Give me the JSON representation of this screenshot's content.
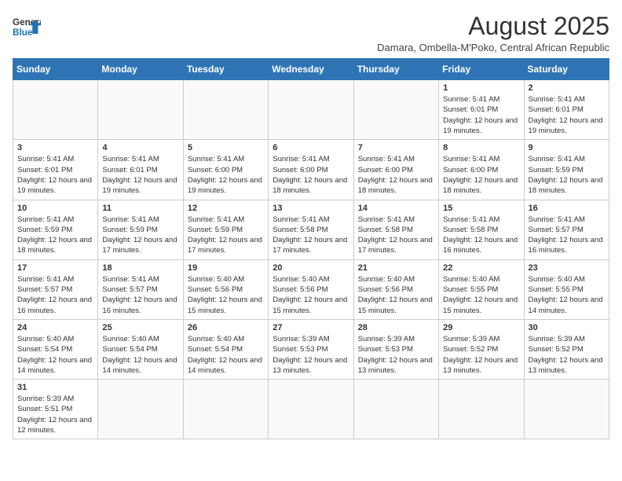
{
  "logo": {
    "general": "General",
    "blue": "Blue"
  },
  "header": {
    "month_year": "August 2025",
    "subtitle": "Damara, Ombella-M'Poko, Central African Republic"
  },
  "days_of_week": [
    "Sunday",
    "Monday",
    "Tuesday",
    "Wednesday",
    "Thursday",
    "Friday",
    "Saturday"
  ],
  "weeks": [
    [
      {
        "day": "",
        "info": ""
      },
      {
        "day": "",
        "info": ""
      },
      {
        "day": "",
        "info": ""
      },
      {
        "day": "",
        "info": ""
      },
      {
        "day": "",
        "info": ""
      },
      {
        "day": "1",
        "info": "Sunrise: 5:41 AM\nSunset: 6:01 PM\nDaylight: 12 hours and 19 minutes."
      },
      {
        "day": "2",
        "info": "Sunrise: 5:41 AM\nSunset: 6:01 PM\nDaylight: 12 hours and 19 minutes."
      }
    ],
    [
      {
        "day": "3",
        "info": "Sunrise: 5:41 AM\nSunset: 6:01 PM\nDaylight: 12 hours and 19 minutes."
      },
      {
        "day": "4",
        "info": "Sunrise: 5:41 AM\nSunset: 6:01 PM\nDaylight: 12 hours and 19 minutes."
      },
      {
        "day": "5",
        "info": "Sunrise: 5:41 AM\nSunset: 6:00 PM\nDaylight: 12 hours and 19 minutes."
      },
      {
        "day": "6",
        "info": "Sunrise: 5:41 AM\nSunset: 6:00 PM\nDaylight: 12 hours and 18 minutes."
      },
      {
        "day": "7",
        "info": "Sunrise: 5:41 AM\nSunset: 6:00 PM\nDaylight: 12 hours and 18 minutes."
      },
      {
        "day": "8",
        "info": "Sunrise: 5:41 AM\nSunset: 6:00 PM\nDaylight: 12 hours and 18 minutes."
      },
      {
        "day": "9",
        "info": "Sunrise: 5:41 AM\nSunset: 5:59 PM\nDaylight: 12 hours and 18 minutes."
      }
    ],
    [
      {
        "day": "10",
        "info": "Sunrise: 5:41 AM\nSunset: 5:59 PM\nDaylight: 12 hours and 18 minutes."
      },
      {
        "day": "11",
        "info": "Sunrise: 5:41 AM\nSunset: 5:59 PM\nDaylight: 12 hours and 17 minutes."
      },
      {
        "day": "12",
        "info": "Sunrise: 5:41 AM\nSunset: 5:59 PM\nDaylight: 12 hours and 17 minutes."
      },
      {
        "day": "13",
        "info": "Sunrise: 5:41 AM\nSunset: 5:58 PM\nDaylight: 12 hours and 17 minutes."
      },
      {
        "day": "14",
        "info": "Sunrise: 5:41 AM\nSunset: 5:58 PM\nDaylight: 12 hours and 17 minutes."
      },
      {
        "day": "15",
        "info": "Sunrise: 5:41 AM\nSunset: 5:58 PM\nDaylight: 12 hours and 16 minutes."
      },
      {
        "day": "16",
        "info": "Sunrise: 5:41 AM\nSunset: 5:57 PM\nDaylight: 12 hours and 16 minutes."
      }
    ],
    [
      {
        "day": "17",
        "info": "Sunrise: 5:41 AM\nSunset: 5:57 PM\nDaylight: 12 hours and 16 minutes."
      },
      {
        "day": "18",
        "info": "Sunrise: 5:41 AM\nSunset: 5:57 PM\nDaylight: 12 hours and 16 minutes."
      },
      {
        "day": "19",
        "info": "Sunrise: 5:40 AM\nSunset: 5:56 PM\nDaylight: 12 hours and 15 minutes."
      },
      {
        "day": "20",
        "info": "Sunrise: 5:40 AM\nSunset: 5:56 PM\nDaylight: 12 hours and 15 minutes."
      },
      {
        "day": "21",
        "info": "Sunrise: 5:40 AM\nSunset: 5:56 PM\nDaylight: 12 hours and 15 minutes."
      },
      {
        "day": "22",
        "info": "Sunrise: 5:40 AM\nSunset: 5:55 PM\nDaylight: 12 hours and 15 minutes."
      },
      {
        "day": "23",
        "info": "Sunrise: 5:40 AM\nSunset: 5:55 PM\nDaylight: 12 hours and 14 minutes."
      }
    ],
    [
      {
        "day": "24",
        "info": "Sunrise: 5:40 AM\nSunset: 5:54 PM\nDaylight: 12 hours and 14 minutes."
      },
      {
        "day": "25",
        "info": "Sunrise: 5:40 AM\nSunset: 5:54 PM\nDaylight: 12 hours and 14 minutes."
      },
      {
        "day": "26",
        "info": "Sunrise: 5:40 AM\nSunset: 5:54 PM\nDaylight: 12 hours and 14 minutes."
      },
      {
        "day": "27",
        "info": "Sunrise: 5:39 AM\nSunset: 5:53 PM\nDaylight: 12 hours and 13 minutes."
      },
      {
        "day": "28",
        "info": "Sunrise: 5:39 AM\nSunset: 5:53 PM\nDaylight: 12 hours and 13 minutes."
      },
      {
        "day": "29",
        "info": "Sunrise: 5:39 AM\nSunset: 5:52 PM\nDaylight: 12 hours and 13 minutes."
      },
      {
        "day": "30",
        "info": "Sunrise: 5:39 AM\nSunset: 5:52 PM\nDaylight: 12 hours and 13 minutes."
      }
    ],
    [
      {
        "day": "31",
        "info": "Sunrise: 5:39 AM\nSunset: 5:51 PM\nDaylight: 12 hours and 12 minutes."
      },
      {
        "day": "",
        "info": ""
      },
      {
        "day": "",
        "info": ""
      },
      {
        "day": "",
        "info": ""
      },
      {
        "day": "",
        "info": ""
      },
      {
        "day": "",
        "info": ""
      },
      {
        "day": "",
        "info": ""
      }
    ]
  ]
}
